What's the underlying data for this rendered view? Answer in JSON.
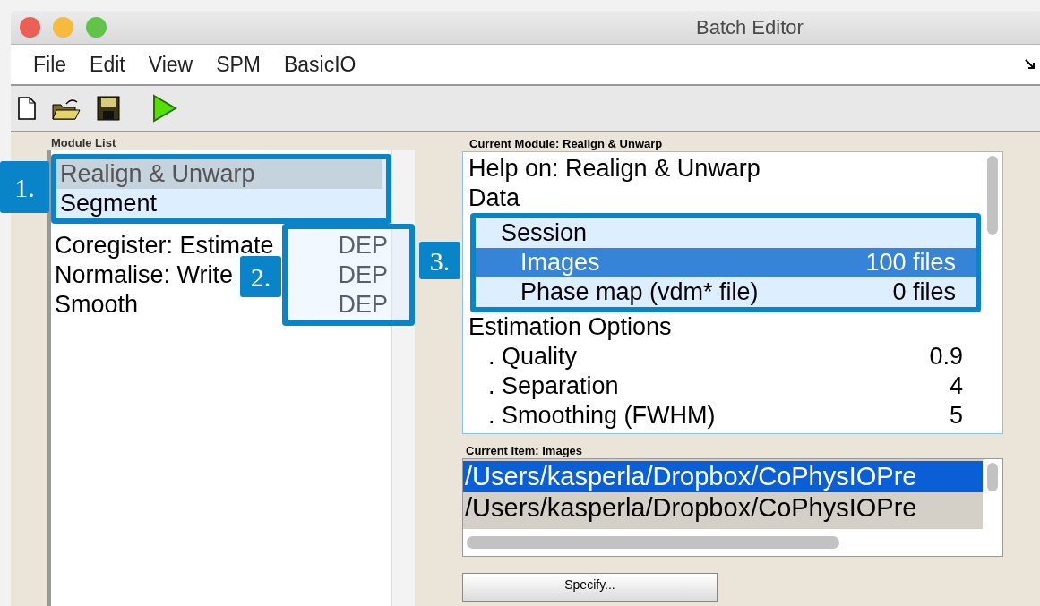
{
  "window": {
    "title": "Batch Editor"
  },
  "menu": [
    "File",
    "Edit",
    "View",
    "SPM",
    "BasicIO"
  ],
  "module_list": {
    "title": "Module List",
    "items": [
      {
        "name": "Realign & Unwarp",
        "selected": true
      },
      {
        "name": "Segment",
        "selected": false
      },
      {
        "name": "Coregister: Estimate",
        "dep": "DEP",
        "selected": false
      },
      {
        "name": "Normalise: Write",
        "dep": "DEP",
        "selected": false
      },
      {
        "name": "Smooth",
        "dep": "DEP",
        "selected": false
      }
    ]
  },
  "current_module": {
    "title": "Current Module: Realign & Unwarp",
    "rows": [
      {
        "label": "Help on: Realign & Unwarp",
        "selected": false
      },
      {
        "label": "Data",
        "selected": false,
        "children": [
          {
            "label": "Session",
            "selected": false,
            "children": [
              {
                "label": "Images",
                "value": "100 files",
                "selected": true
              },
              {
                "label": "Phase map (vdm* file)",
                "value": "0 files",
                "selected": false
              }
            ]
          }
        ]
      },
      {
        "label": "Estimation Options",
        "selected": false,
        "children": [
          {
            "label": ". Quality",
            "value": "0.9",
            "selected": false
          },
          {
            "label": ". Separation",
            "value": "4",
            "selected": false
          },
          {
            "label": ". Smoothing (FWHM)",
            "value": "5",
            "selected": false
          }
        ]
      }
    ]
  },
  "current_item": {
    "title": "Current Item: Images",
    "rows": [
      {
        "path": "/Users/kasperla/Dropbox/CoPhysIOPre",
        "selected": true
      },
      {
        "path": "/Users/kasperla/Dropbox/CoPhysIOPre",
        "selected": false
      }
    ]
  },
  "specify_button": "Specify...",
  "annotations": [
    {
      "label": "1."
    },
    {
      "label": "2."
    },
    {
      "label": "3."
    }
  ]
}
